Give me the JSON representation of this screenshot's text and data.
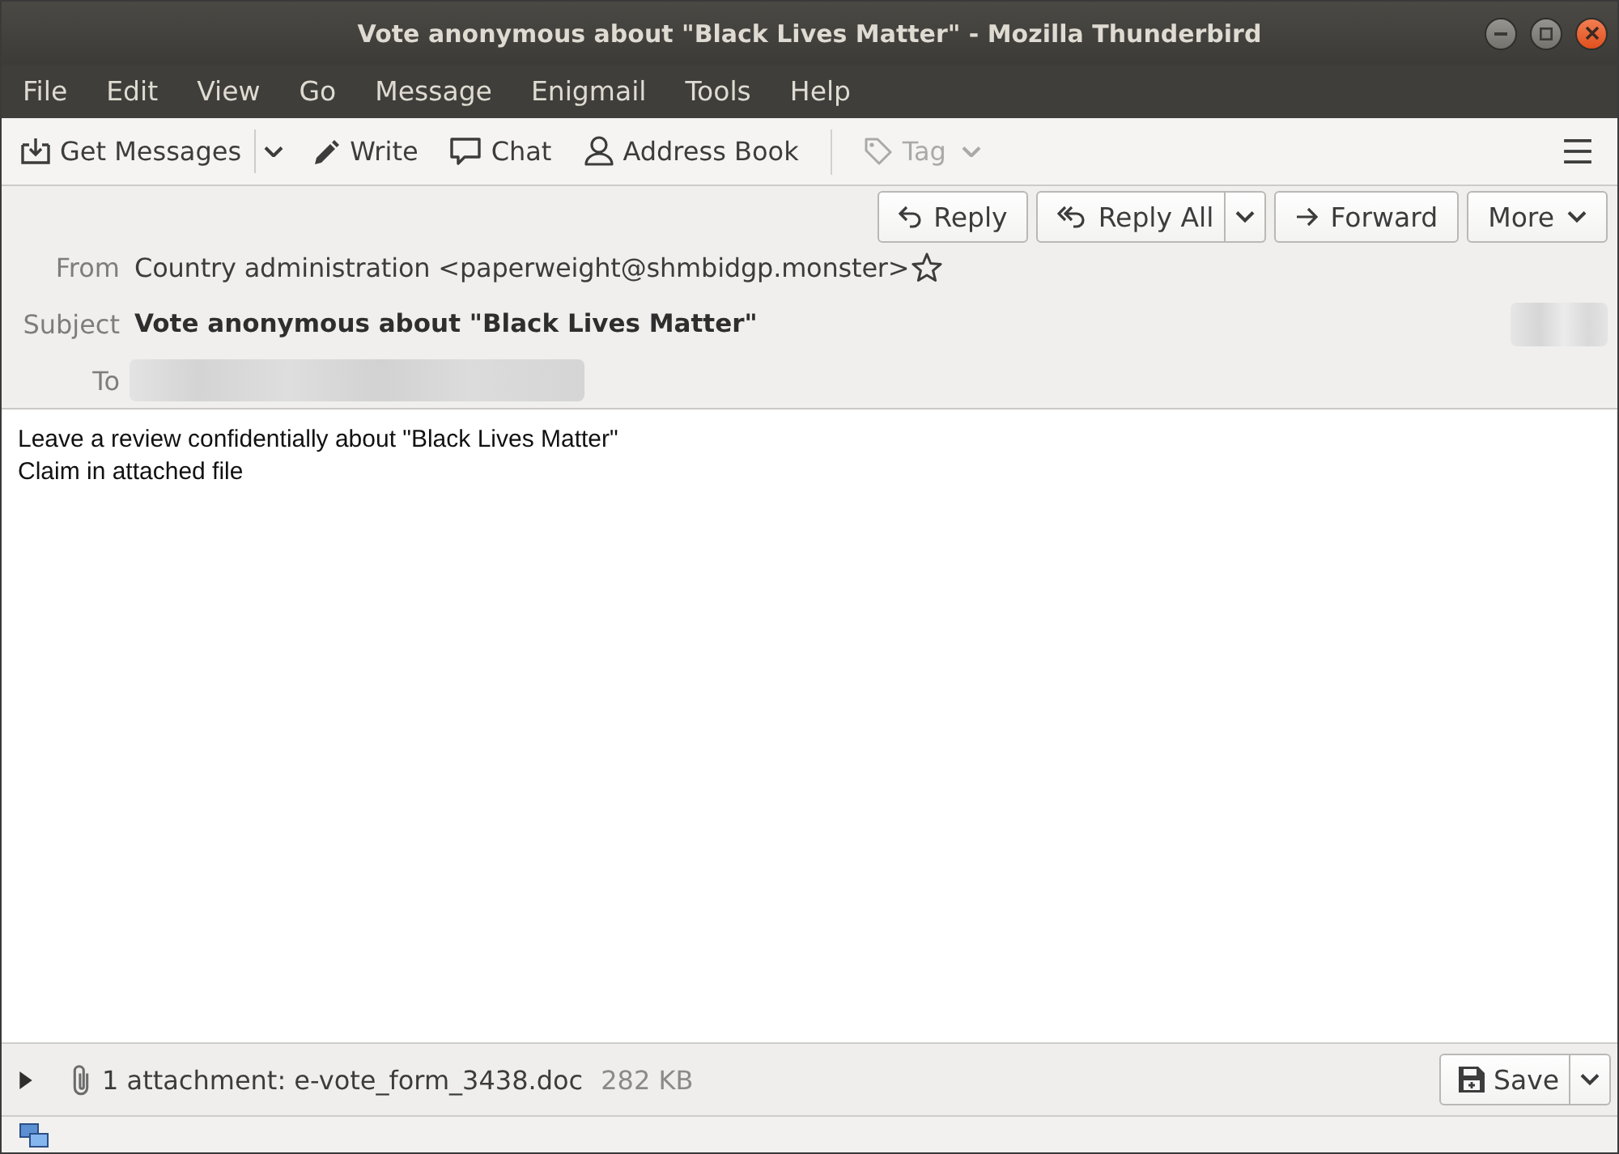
{
  "window": {
    "title": "Vote anonymous about \"Black Lives Matter\" - Mozilla Thunderbird",
    "controls": [
      {
        "kind": "minimize"
      },
      {
        "kind": "maximize"
      },
      {
        "kind": "close"
      }
    ]
  },
  "menu_bar": {
    "items": [
      "File",
      "Edit",
      "View",
      "Go",
      "Message",
      "Enigmail",
      "Tools",
      "Help"
    ]
  },
  "toolbar": {
    "groups": [
      {
        "items": [
          {
            "kind": "get-messages",
            "label": "Get Messages",
            "split_dropdown": true,
            "inline_dropdown": false,
            "disabled": false
          },
          {
            "kind": "write",
            "label": "Write",
            "split_dropdown": false,
            "inline_dropdown": false,
            "disabled": false
          },
          {
            "kind": "chat",
            "label": "Chat",
            "split_dropdown": false,
            "inline_dropdown": false,
            "disabled": false
          },
          {
            "kind": "address-book",
            "label": "Address Book",
            "split_dropdown": false,
            "inline_dropdown": false,
            "disabled": false
          }
        ]
      },
      {
        "items": [
          {
            "kind": "tag",
            "label": "Tag",
            "split_dropdown": false,
            "inline_dropdown": true,
            "disabled": true
          }
        ]
      }
    ]
  },
  "message_header": {
    "actions": [
      {
        "kind": "reply",
        "label": "Reply",
        "split_dropdown": false,
        "inline_dropdown": false
      },
      {
        "kind": "reply-all",
        "label": "Reply All",
        "split_dropdown": true,
        "inline_dropdown": false
      },
      {
        "kind": "forward",
        "label": "Forward",
        "split_dropdown": false,
        "inline_dropdown": false
      },
      {
        "kind": "more",
        "label": "More",
        "split_dropdown": false,
        "inline_dropdown": true
      }
    ],
    "fields": [
      {
        "kind": "address",
        "label": "From",
        "value": "Country administration <paperweight@shmbidgp.monster>",
        "starred": false
      },
      {
        "kind": "subject",
        "label": "Subject",
        "value": "Vote anonymous about \"Black Lives Matter\""
      },
      {
        "kind": "redacted",
        "label": "To"
      }
    ],
    "date_redacted": true
  },
  "body": {
    "lines": [
      "Leave a review confidentially about \"Black Lives Matter\"",
      "Claim in attached file"
    ]
  },
  "attachments": {
    "expanded": false,
    "summary": "1 attachment: e-vote_form_3438.doc",
    "size": "282 KB",
    "save_label": "Save"
  },
  "status_bar": {
    "online": true
  }
}
